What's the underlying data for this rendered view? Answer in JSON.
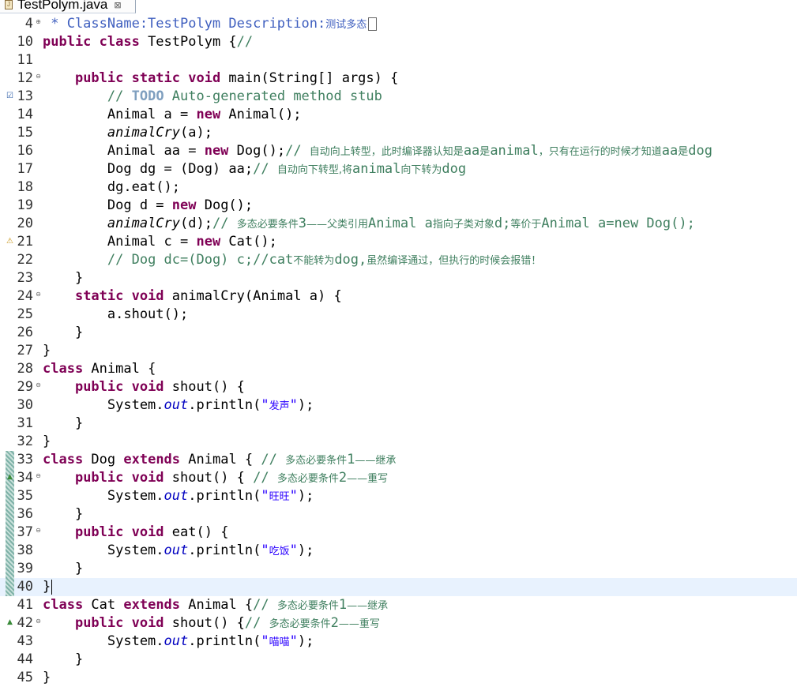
{
  "tab": {
    "title": "TestPolym.java",
    "close_glyph": "⊠"
  },
  "lines": [
    {
      "n": "4",
      "fold": "⊕",
      "segs": [
        {
          "t": " * ClassName:TestPolym Description:",
          "c": "jd"
        },
        {
          "t": "测试多态",
          "c": "jd cjk"
        }
      ],
      "box": true
    },
    {
      "n": "10",
      "segs": [
        {
          "t": "public class",
          "c": "kw"
        },
        {
          "t": " TestPolym {"
        },
        {
          "t": "//",
          "c": "cm"
        }
      ]
    },
    {
      "n": "11",
      "segs": []
    },
    {
      "n": "12",
      "fold": "⊖",
      "segs": [
        {
          "t": "    "
        },
        {
          "t": "public static void",
          "c": "kw"
        },
        {
          "t": " main(String[] args) {"
        }
      ]
    },
    {
      "n": "13",
      "marker": "☑",
      "mclass": "task",
      "segs": [
        {
          "t": "        "
        },
        {
          "t": "// ",
          "c": "cm"
        },
        {
          "t": "TODO",
          "c": "todo"
        },
        {
          "t": " Auto-generated method stub",
          "c": "cm"
        }
      ]
    },
    {
      "n": "14",
      "segs": [
        {
          "t": "        Animal a = "
        },
        {
          "t": "new",
          "c": "kw"
        },
        {
          "t": " Animal();"
        }
      ]
    },
    {
      "n": "15",
      "segs": [
        {
          "t": "        "
        },
        {
          "t": "animalCry",
          "c": "it"
        },
        {
          "t": "(a);"
        }
      ]
    },
    {
      "n": "16",
      "segs": [
        {
          "t": "        Animal aa = "
        },
        {
          "t": "new",
          "c": "kw"
        },
        {
          "t": " Dog();"
        },
        {
          "t": "// ",
          "c": "cm"
        },
        {
          "t": "自动向上转型，此时编译器认知是",
          "c": "cm cjk"
        },
        {
          "t": "aa",
          "c": "cm"
        },
        {
          "t": "是",
          "c": "cm cjk"
        },
        {
          "t": "animal",
          "c": "cm"
        },
        {
          "t": "，只有在运行的时候才知道",
          "c": "cm cjk"
        },
        {
          "t": "aa",
          "c": "cm"
        },
        {
          "t": "是",
          "c": "cm cjk"
        },
        {
          "t": "dog",
          "c": "cm"
        }
      ]
    },
    {
      "n": "17",
      "segs": [
        {
          "t": "        Dog dg = (Dog) aa;"
        },
        {
          "t": "// ",
          "c": "cm"
        },
        {
          "t": "自动向下转型,",
          "c": "cm cjk"
        },
        {
          "t": "将",
          "c": "cm cjk"
        },
        {
          "t": "animal",
          "c": "cm"
        },
        {
          "t": "向下转为",
          "c": "cm cjk"
        },
        {
          "t": "dog",
          "c": "cm"
        }
      ]
    },
    {
      "n": "18",
      "segs": [
        {
          "t": "        dg.eat();"
        }
      ]
    },
    {
      "n": "19",
      "segs": [
        {
          "t": "        Dog d = "
        },
        {
          "t": "new",
          "c": "kw"
        },
        {
          "t": " Dog();"
        }
      ]
    },
    {
      "n": "20",
      "segs": [
        {
          "t": "        "
        },
        {
          "t": "animalCry",
          "c": "it"
        },
        {
          "t": "(d);"
        },
        {
          "t": "// ",
          "c": "cm"
        },
        {
          "t": "多态必要条件",
          "c": "cm cjk"
        },
        {
          "t": "3",
          "c": "cm"
        },
        {
          "t": "——父类引用",
          "c": "cm cjk"
        },
        {
          "t": "Animal a",
          "c": "cm"
        },
        {
          "t": "指向子类对象",
          "c": "cm cjk"
        },
        {
          "t": "d;",
          "c": "cm"
        },
        {
          "t": "等价于",
          "c": "cm cjk"
        },
        {
          "t": "Animal a=new Dog();",
          "c": "cm"
        }
      ]
    },
    {
      "n": "21",
      "marker": "⚠",
      "mclass": "warn",
      "segs": [
        {
          "t": "        Animal c = "
        },
        {
          "t": "new",
          "c": "kw"
        },
        {
          "t": " Cat();"
        }
      ]
    },
    {
      "n": "22",
      "segs": [
        {
          "t": "        "
        },
        {
          "t": "// Dog dc=(Dog) c;//cat",
          "c": "cm"
        },
        {
          "t": "不能转为",
          "c": "cm cjk"
        },
        {
          "t": "dog,",
          "c": "cm"
        },
        {
          "t": "虽然编译通过，但执行的时候会报错！",
          "c": "cm cjk"
        }
      ]
    },
    {
      "n": "23",
      "segs": [
        {
          "t": "    }"
        }
      ]
    },
    {
      "n": "24",
      "fold": "⊖",
      "segs": [
        {
          "t": "    "
        },
        {
          "t": "static void",
          "c": "kw"
        },
        {
          "t": " animalCry(Animal a) {"
        }
      ]
    },
    {
      "n": "25",
      "segs": [
        {
          "t": "        a.shout();"
        }
      ]
    },
    {
      "n": "26",
      "segs": [
        {
          "t": "    }"
        }
      ]
    },
    {
      "n": "27",
      "segs": [
        {
          "t": "}"
        }
      ]
    },
    {
      "n": "28",
      "segs": [
        {
          "t": "class",
          "c": "kw"
        },
        {
          "t": " Animal {"
        }
      ]
    },
    {
      "n": "29",
      "fold": "⊖",
      "segs": [
        {
          "t": "    "
        },
        {
          "t": "public void",
          "c": "kw"
        },
        {
          "t": " shout() {"
        }
      ]
    },
    {
      "n": "30",
      "segs": [
        {
          "t": "        System."
        },
        {
          "t": "out",
          "c": "sf"
        },
        {
          "t": ".println("
        },
        {
          "t": "\"",
          "c": "st"
        },
        {
          "t": "发声",
          "c": "st cjk"
        },
        {
          "t": "\"",
          "c": "st"
        },
        {
          "t": ");"
        }
      ]
    },
    {
      "n": "31",
      "segs": [
        {
          "t": "    }"
        }
      ]
    },
    {
      "n": "32",
      "segs": [
        {
          "t": "}"
        }
      ]
    },
    {
      "n": "33",
      "bar": true,
      "segs": [
        {
          "t": "class",
          "c": "kw"
        },
        {
          "t": " Dog "
        },
        {
          "t": "extends",
          "c": "kw"
        },
        {
          "t": " Animal { "
        },
        {
          "t": "// ",
          "c": "cm"
        },
        {
          "t": "多态必要条件",
          "c": "cm cjk"
        },
        {
          "t": "1",
          "c": "cm"
        },
        {
          "t": "——继承",
          "c": "cm cjk"
        }
      ]
    },
    {
      "n": "34",
      "bar": true,
      "marker": "▲",
      "mclass": "over",
      "fold": "⊖",
      "segs": [
        {
          "t": "    "
        },
        {
          "t": "public void",
          "c": "kw"
        },
        {
          "t": " shout() { "
        },
        {
          "t": "// ",
          "c": "cm"
        },
        {
          "t": "多态必要条件",
          "c": "cm cjk"
        },
        {
          "t": "2",
          "c": "cm"
        },
        {
          "t": "——重写",
          "c": "cm cjk"
        }
      ]
    },
    {
      "n": "35",
      "bar": true,
      "segs": [
        {
          "t": "        System."
        },
        {
          "t": "out",
          "c": "sf"
        },
        {
          "t": ".println("
        },
        {
          "t": "\"",
          "c": "st"
        },
        {
          "t": "旺旺",
          "c": "st cjk"
        },
        {
          "t": "\"",
          "c": "st"
        },
        {
          "t": ");"
        }
      ]
    },
    {
      "n": "36",
      "bar": true,
      "segs": [
        {
          "t": "    }"
        }
      ]
    },
    {
      "n": "37",
      "bar": true,
      "fold": "⊖",
      "segs": [
        {
          "t": "    "
        },
        {
          "t": "public void",
          "c": "kw"
        },
        {
          "t": " eat() {"
        }
      ]
    },
    {
      "n": "38",
      "bar": true,
      "segs": [
        {
          "t": "        System."
        },
        {
          "t": "out",
          "c": "sf"
        },
        {
          "t": ".println("
        },
        {
          "t": "\"",
          "c": "st"
        },
        {
          "t": "吃饭",
          "c": "st cjk"
        },
        {
          "t": "\"",
          "c": "st"
        },
        {
          "t": ");"
        }
      ]
    },
    {
      "n": "39",
      "bar": true,
      "segs": [
        {
          "t": "    }"
        }
      ]
    },
    {
      "n": "40",
      "bar": true,
      "current": true,
      "caret": true,
      "segs": [
        {
          "t": "}"
        }
      ]
    },
    {
      "n": "41",
      "segs": [
        {
          "t": "class",
          "c": "kw"
        },
        {
          "t": " Cat "
        },
        {
          "t": "extends",
          "c": "kw"
        },
        {
          "t": " Animal {"
        },
        {
          "t": "// ",
          "c": "cm"
        },
        {
          "t": "多态必要条件",
          "c": "cm cjk"
        },
        {
          "t": "1",
          "c": "cm"
        },
        {
          "t": "——继承",
          "c": "cm cjk"
        }
      ]
    },
    {
      "n": "42",
      "marker": "▲",
      "mclass": "over",
      "fold": "⊖",
      "segs": [
        {
          "t": "    "
        },
        {
          "t": "public void",
          "c": "kw"
        },
        {
          "t": " shout() {"
        },
        {
          "t": "// ",
          "c": "cm"
        },
        {
          "t": "多态必要条件",
          "c": "cm cjk"
        },
        {
          "t": "2",
          "c": "cm"
        },
        {
          "t": "——重写",
          "c": "cm cjk"
        }
      ]
    },
    {
      "n": "43",
      "segs": [
        {
          "t": "        System."
        },
        {
          "t": "out",
          "c": "sf"
        },
        {
          "t": ".println("
        },
        {
          "t": "\"",
          "c": "st"
        },
        {
          "t": "喵喵",
          "c": "st cjk"
        },
        {
          "t": "\"",
          "c": "st"
        },
        {
          "t": ");"
        }
      ]
    },
    {
      "n": "44",
      "segs": [
        {
          "t": "    }"
        }
      ]
    },
    {
      "n": "45",
      "segs": [
        {
          "t": "}"
        }
      ]
    }
  ]
}
